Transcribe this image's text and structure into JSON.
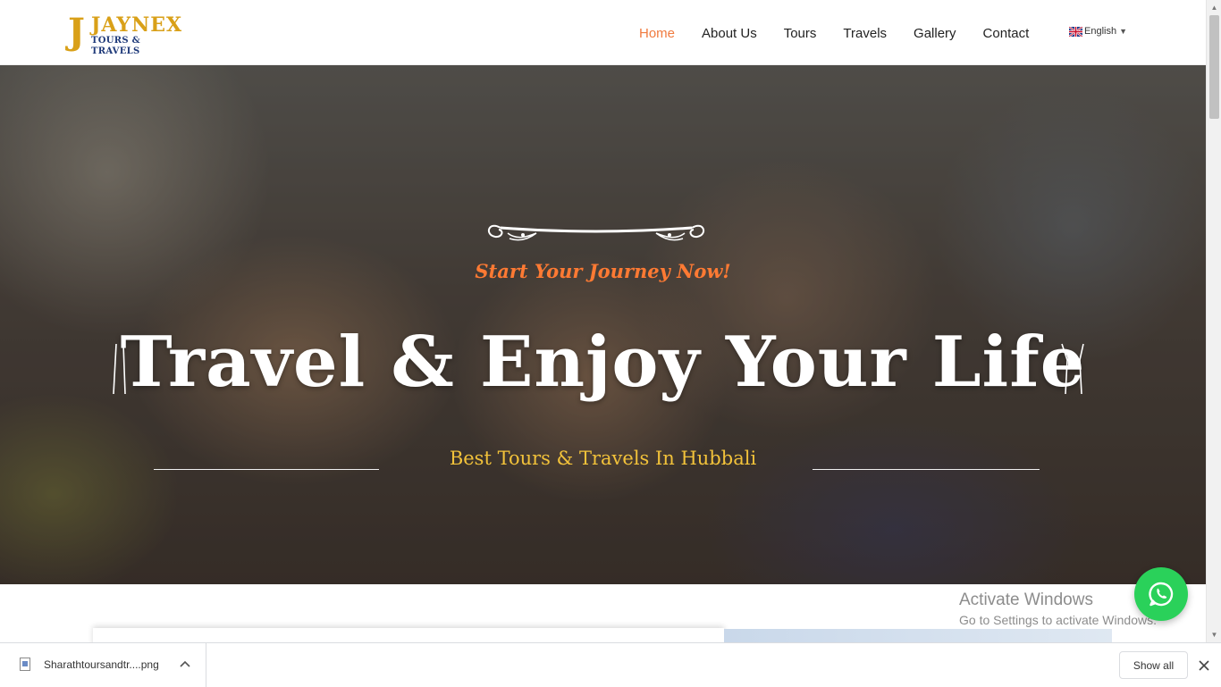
{
  "header": {
    "logo": {
      "letter": "J",
      "name": "JAYNEX",
      "sub": "TOURS & TRAVELS"
    },
    "nav": [
      {
        "label": "Home",
        "active": true
      },
      {
        "label": "About Us",
        "active": false
      },
      {
        "label": "Tours",
        "active": false
      },
      {
        "label": "Travels",
        "active": false
      },
      {
        "label": "Gallery",
        "active": false
      },
      {
        "label": "Contact",
        "active": false
      }
    ],
    "language": {
      "label": "English",
      "icon": "uk-flag-icon"
    }
  },
  "hero": {
    "tagline": "Start Your Journey Now!",
    "headline": "Travel & Enjoy Your Life",
    "subline": "Best Tours & Travels In Hubbali"
  },
  "overlay": {
    "watermark_title": "Activate Windows",
    "watermark_sub": "Go to Settings to activate Windows.",
    "whatsapp_icon": "whatsapp-icon"
  },
  "downloads": {
    "file_name": "Sharathtoursandtr....png",
    "show_all": "Show all"
  },
  "colors": {
    "accent_orange": "#f07b3f",
    "tagline_orange": "#ff7a33",
    "subline_gold": "#f2c23a",
    "logo_gold": "#d9a018",
    "logo_blue": "#1f3a7a",
    "whatsapp_green": "#2ad15a"
  }
}
